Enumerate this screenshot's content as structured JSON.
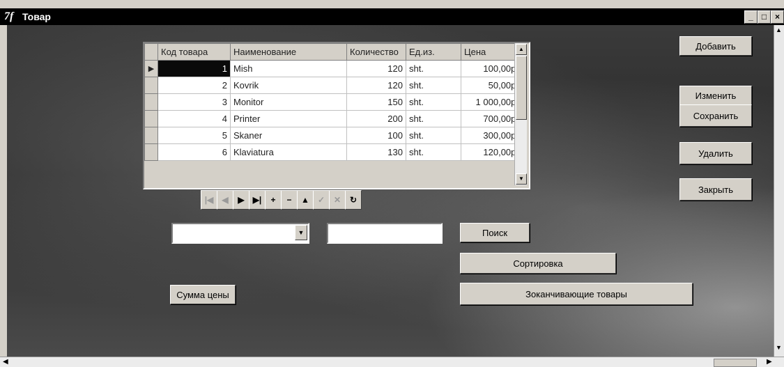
{
  "window": {
    "logo": "7f",
    "title": "Товар",
    "controls": {
      "minimize": "_",
      "maximize": "□",
      "close": "×"
    }
  },
  "grid": {
    "columns": [
      "Код товара",
      "Наименование",
      "Количество",
      "Ед.из.",
      "Цена"
    ],
    "rows": [
      {
        "code": "1",
        "name": "Mish",
        "qty": "120",
        "unit": "sht.",
        "price": "100,00р."
      },
      {
        "code": "2",
        "name": "Kovrik",
        "qty": "120",
        "unit": "sht.",
        "price": "50,00р."
      },
      {
        "code": "3",
        "name": "Monitor",
        "qty": "150",
        "unit": "sht.",
        "price": "1 000,00р."
      },
      {
        "code": "4",
        "name": "Printer",
        "qty": "200",
        "unit": "sht.",
        "price": "700,00р."
      },
      {
        "code": "5",
        "name": "Skaner",
        "qty": "100",
        "unit": "sht.",
        "price": "300,00р."
      },
      {
        "code": "6",
        "name": "Klaviatura",
        "qty": "130",
        "unit": "sht.",
        "price": "120,00р."
      }
    ],
    "current_row_marker": "▶"
  },
  "actions": {
    "add": "Добавить",
    "edit": "Изменить",
    "save": "Сохранить",
    "delete": "Удалить",
    "close": "Закрыть"
  },
  "navigator": {
    "first": "|◀",
    "prior": "◀",
    "next": "▶",
    "last": "▶|",
    "insert": "+",
    "delete": "−",
    "edit": "▲",
    "post": "✓",
    "cancel": "✕",
    "refresh": "↻"
  },
  "search": {
    "field_value": "",
    "text_value": "",
    "search_button": "Поиск",
    "sort_button": "Сортировка",
    "price_sum_button": "Сумма цены",
    "ending_goods_button": "Зоканчивающие товары"
  }
}
